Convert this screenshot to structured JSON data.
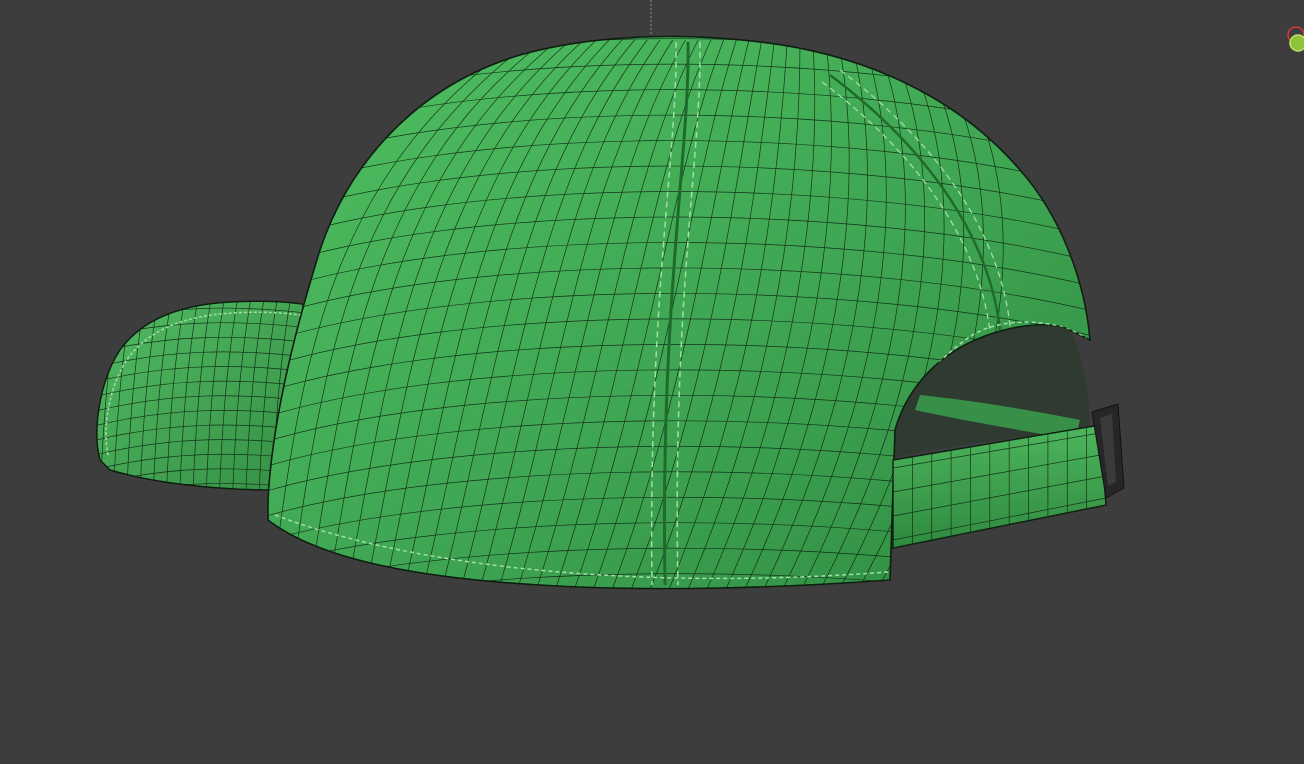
{
  "viewport": {
    "background_color": "#3d3d3d",
    "shading_mode": "solid-wireframe"
  },
  "model": {
    "object": "baseball-cap",
    "view": "back-three-quarter",
    "colors": {
      "fabric": "#3fa653",
      "fabric_light": "#5cc46b",
      "fabric_shadow": "#2e8a3f",
      "wire": "#0d1f10",
      "stitch": "#9fe0a4",
      "buckle": "#262626",
      "interior_shadow": "#2f3a30"
    }
  },
  "gizmo": {
    "icons": [
      "x-axis-icon",
      "y-axis-icon"
    ],
    "colors": {
      "x_axis": "#d63a3a",
      "y_axis": "#8ec23a"
    }
  },
  "ui": {
    "origin_line_color": "#8a8a8a"
  }
}
